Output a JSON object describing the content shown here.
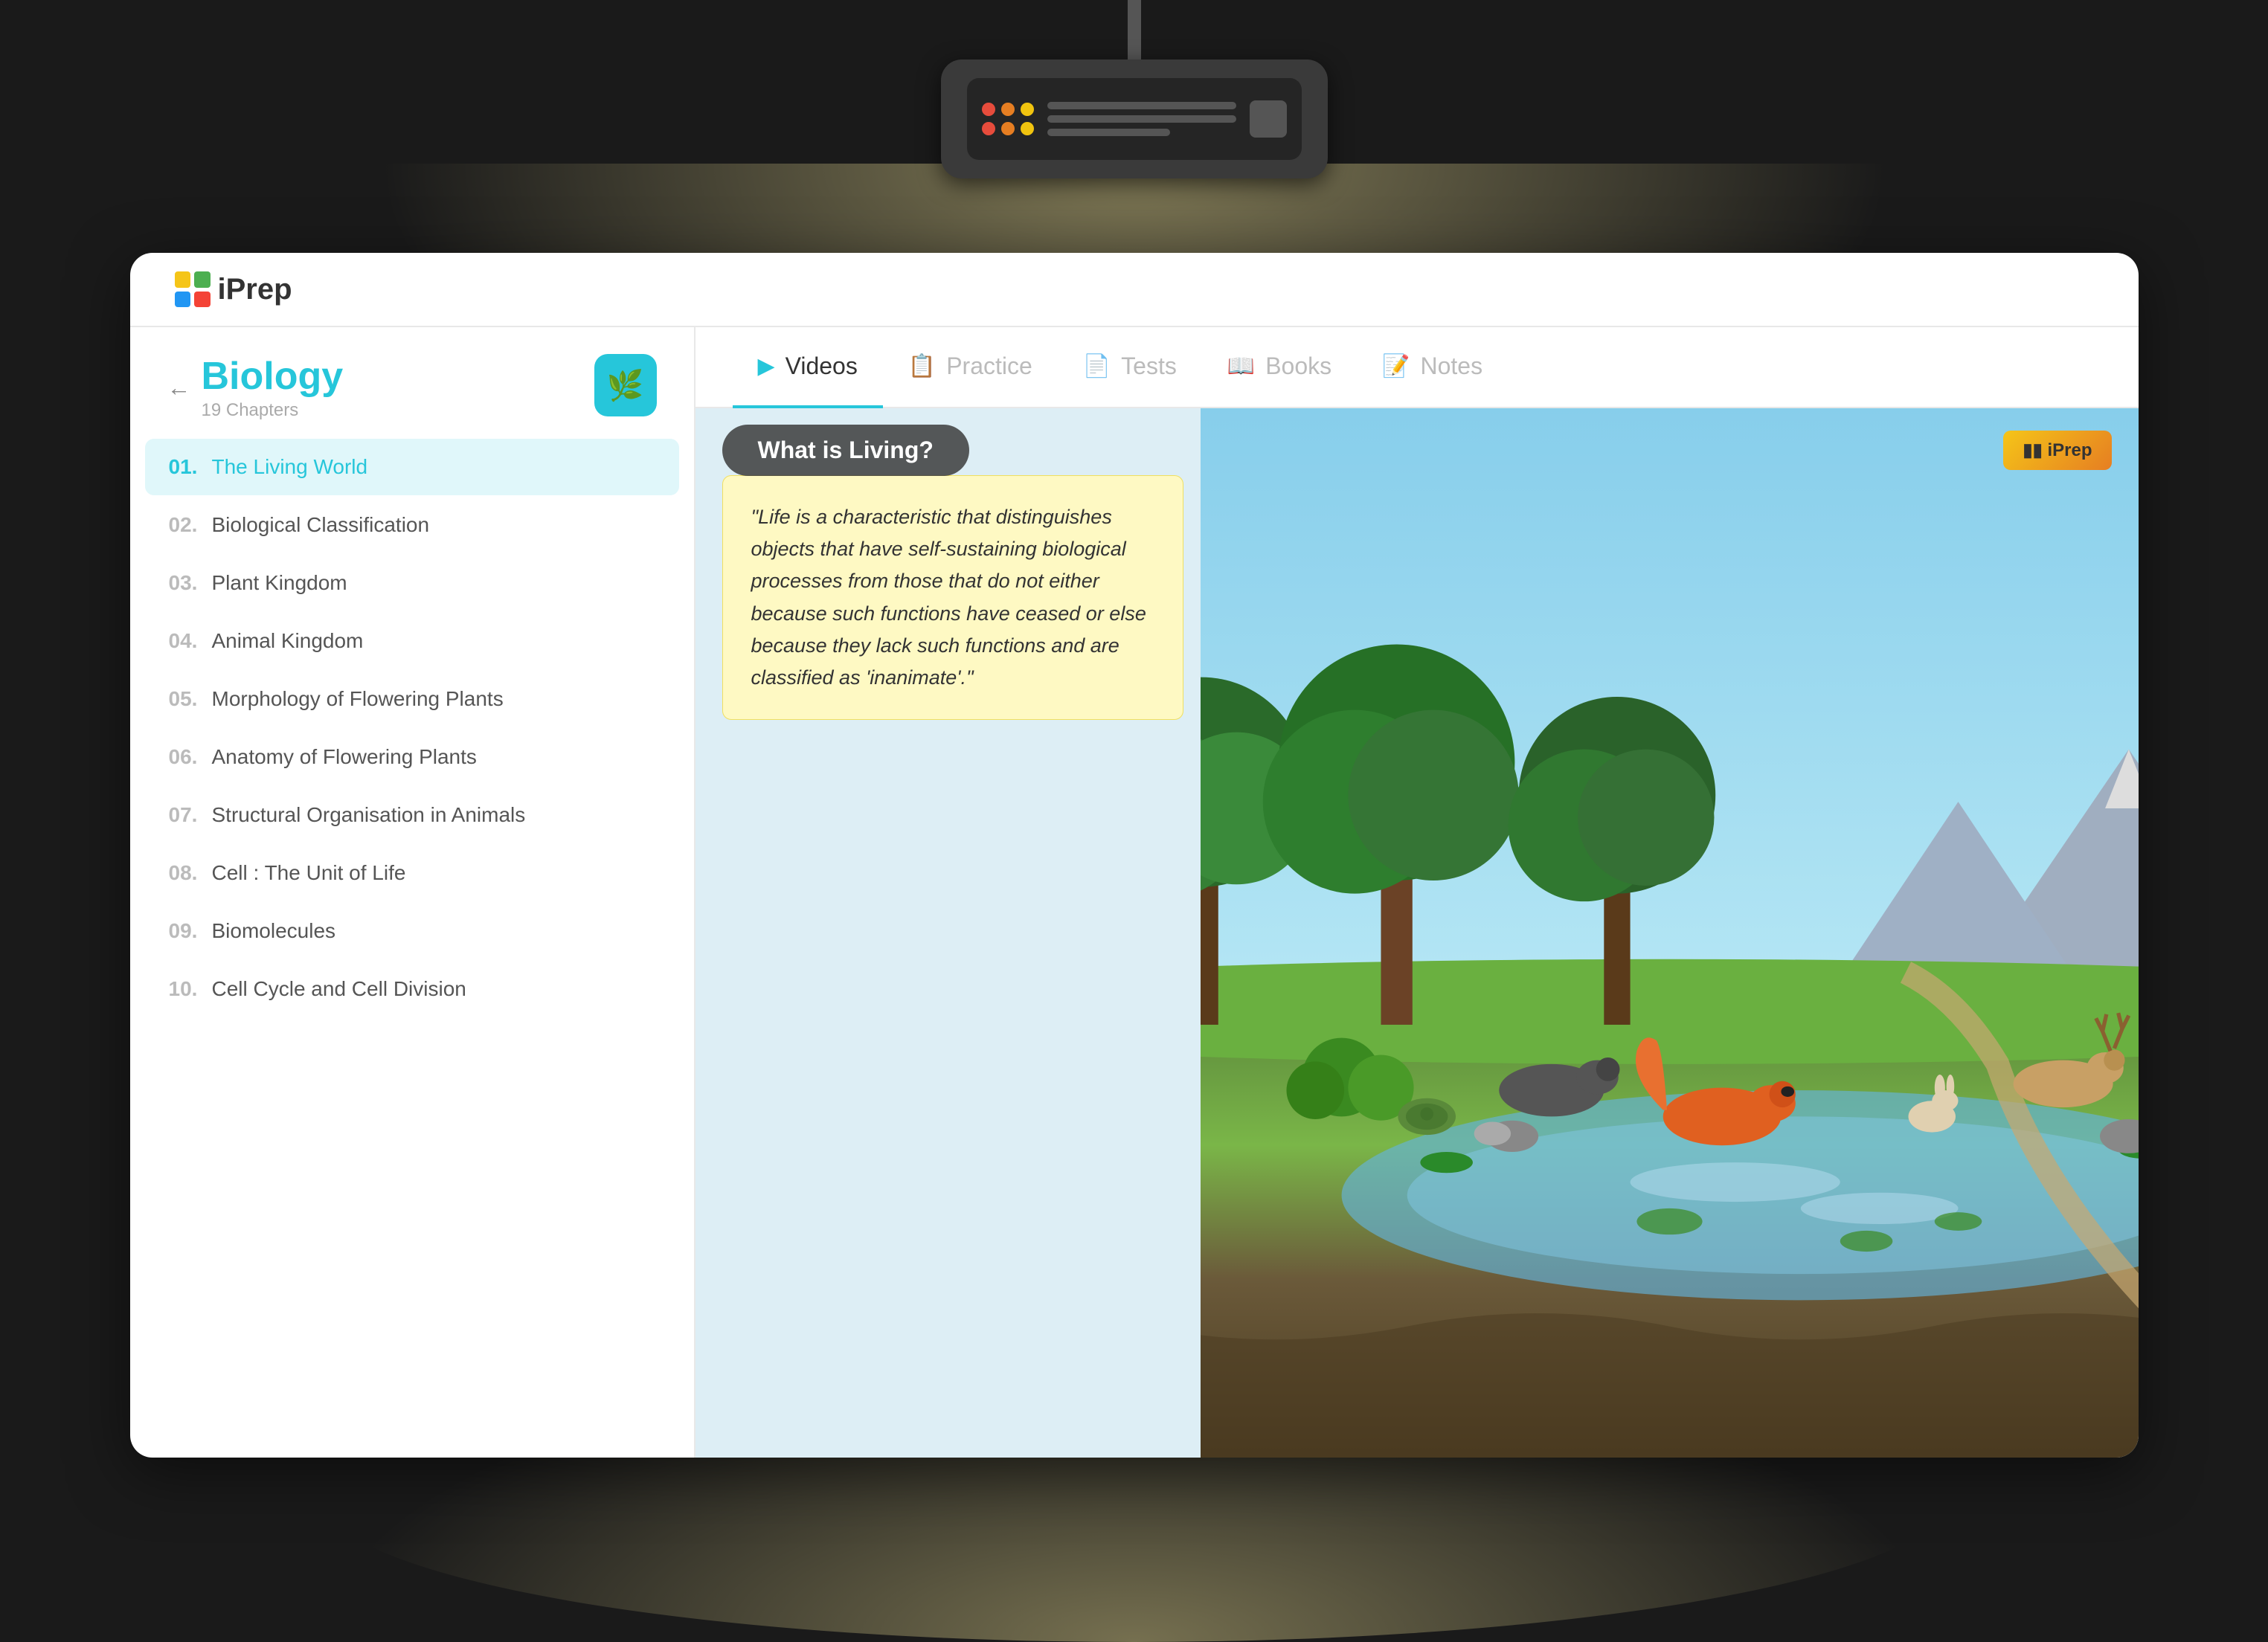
{
  "app": {
    "logo_text": "iPrep"
  },
  "sidebar": {
    "back_label": "←",
    "subject_title": "Biology",
    "subject_subtitle": "19 Chapters",
    "subject_icon": "🌿",
    "chapters": [
      {
        "num": "01.",
        "title": "The Living World",
        "active": true
      },
      {
        "num": "02.",
        "title": "Biological Classification",
        "active": false
      },
      {
        "num": "03.",
        "title": "Plant Kingdom",
        "active": false
      },
      {
        "num": "04.",
        "title": "Animal Kingdom",
        "active": false
      },
      {
        "num": "05.",
        "title": "Morphology of Flowering Plants",
        "active": false
      },
      {
        "num": "06.",
        "title": "Anatomy of Flowering Plants",
        "active": false
      },
      {
        "num": "07.",
        "title": "Structural Organisation in Animals",
        "active": false
      },
      {
        "num": "08.",
        "title": "Cell : The Unit of Life",
        "active": false
      },
      {
        "num": "09.",
        "title": "Biomolecules",
        "active": false
      },
      {
        "num": "10.",
        "title": "Cell Cycle and Cell Division",
        "active": false
      }
    ]
  },
  "tabs": [
    {
      "id": "videos",
      "label": "Videos",
      "icon": "▶",
      "active": true
    },
    {
      "id": "practice",
      "label": "Practice",
      "icon": "📋",
      "active": false
    },
    {
      "id": "tests",
      "label": "Tests",
      "icon": "📄",
      "active": false
    },
    {
      "id": "books",
      "label": "Books",
      "icon": "📖",
      "active": false
    },
    {
      "id": "notes",
      "label": "Notes",
      "icon": "📝",
      "active": false
    }
  ],
  "video": {
    "title": "What is Living?",
    "iprep_badge": "▮▮ iPrep",
    "info_text": "\"Life is a characteristic that distinguishes objects that have self-sustaining biological processes from those that do not either because such functions have ceased or else because they lack such functions and are classified as 'inanimate'.\""
  },
  "projector": {
    "dots": [
      "red",
      "orange",
      "yellow"
    ],
    "label": "Projector"
  }
}
